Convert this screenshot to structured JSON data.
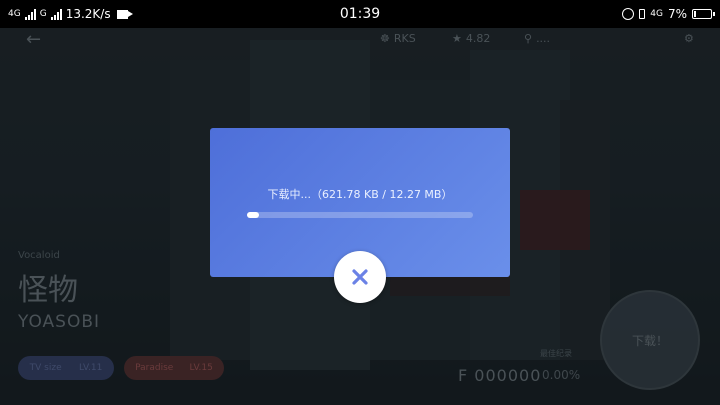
{
  "status_bar": {
    "net1": "4G",
    "net2": "G",
    "speed": "13.2K/s",
    "time": "01:39",
    "net_right": "4G",
    "battery": "7%"
  },
  "header": {
    "stat1": "RKS",
    "stat2": "4.82",
    "stat3": "...."
  },
  "song": {
    "label": "Vocaloid",
    "title": "怪物",
    "artist": "YOASOBI",
    "difficulty1_name": "TV size",
    "difficulty1_level": "LV.11",
    "difficulty2_name": "Paradise",
    "difficulty2_level": "LV.15",
    "best_label": "最佳纪录",
    "score": "F 000000",
    "accuracy": "0.00%",
    "download_label": "下载！"
  },
  "dialog": {
    "status_text": "下载中...（621.78 KB / 12.27 MB）",
    "progress": 0.049
  },
  "colors": {
    "dialog_start": "#4e6fd9",
    "dialog_end": "#6a8fea",
    "close_x": "#6b82e6"
  }
}
